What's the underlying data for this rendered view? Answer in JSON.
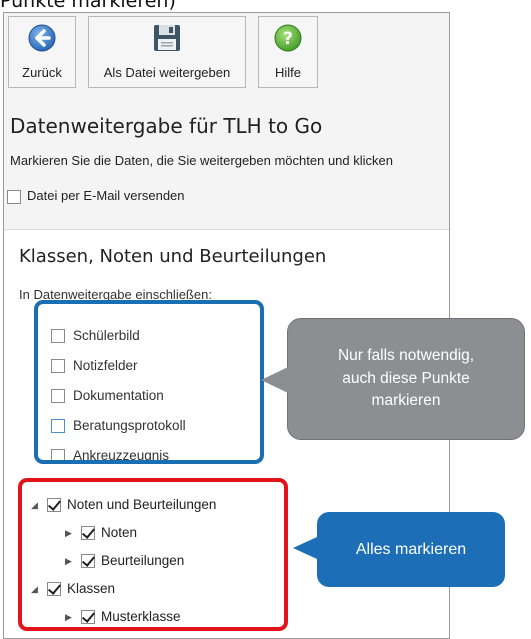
{
  "caption": "Punkte markieren)",
  "toolbar": {
    "back_label": "Zurück",
    "share_label": "Als Datei weitergeben",
    "help_label": "Hilfe"
  },
  "header": {
    "title": "Datenweitergabe für TLH to Go",
    "instructions": "Markieren Sie die Daten, die Sie weitergeben möchten und klicken"
  },
  "email": {
    "label": "Datei per E-Mail versenden",
    "checked": false
  },
  "section": {
    "title": "Klassen, Noten und Beurteilungen",
    "include_label": "In Datenweitergabe einschließen:"
  },
  "options": [
    {
      "label": "Schülerbild",
      "checked": false
    },
    {
      "label": "Notizfelder",
      "checked": false
    },
    {
      "label": "Dokumentation",
      "checked": false
    },
    {
      "label": "Beratungsprotokoll",
      "checked": false
    },
    {
      "label": "Ankreuzzeugnis",
      "checked": false
    }
  ],
  "tree": [
    {
      "label": "Noten und Beurteilungen",
      "expanded": true,
      "checked": true
    },
    {
      "label": "Noten",
      "expanded": false,
      "checked": true
    },
    {
      "label": "Beurteilungen",
      "expanded": false,
      "checked": true
    },
    {
      "label": "Klassen",
      "expanded": true,
      "checked": true
    },
    {
      "label": "Musterklasse",
      "expanded": false,
      "checked": true
    }
  ],
  "callouts": {
    "optional_line1": "Nur falls notwendig,",
    "optional_line2": "auch diese Punkte",
    "optional_line3": "markieren",
    "mark_all": "Alles markieren"
  },
  "colors": {
    "highlight_blue": "#1a6fb3",
    "highlight_red": "#e1141c",
    "callout_grey": "#8c8e91",
    "callout_blue": "#1c6fb6"
  }
}
